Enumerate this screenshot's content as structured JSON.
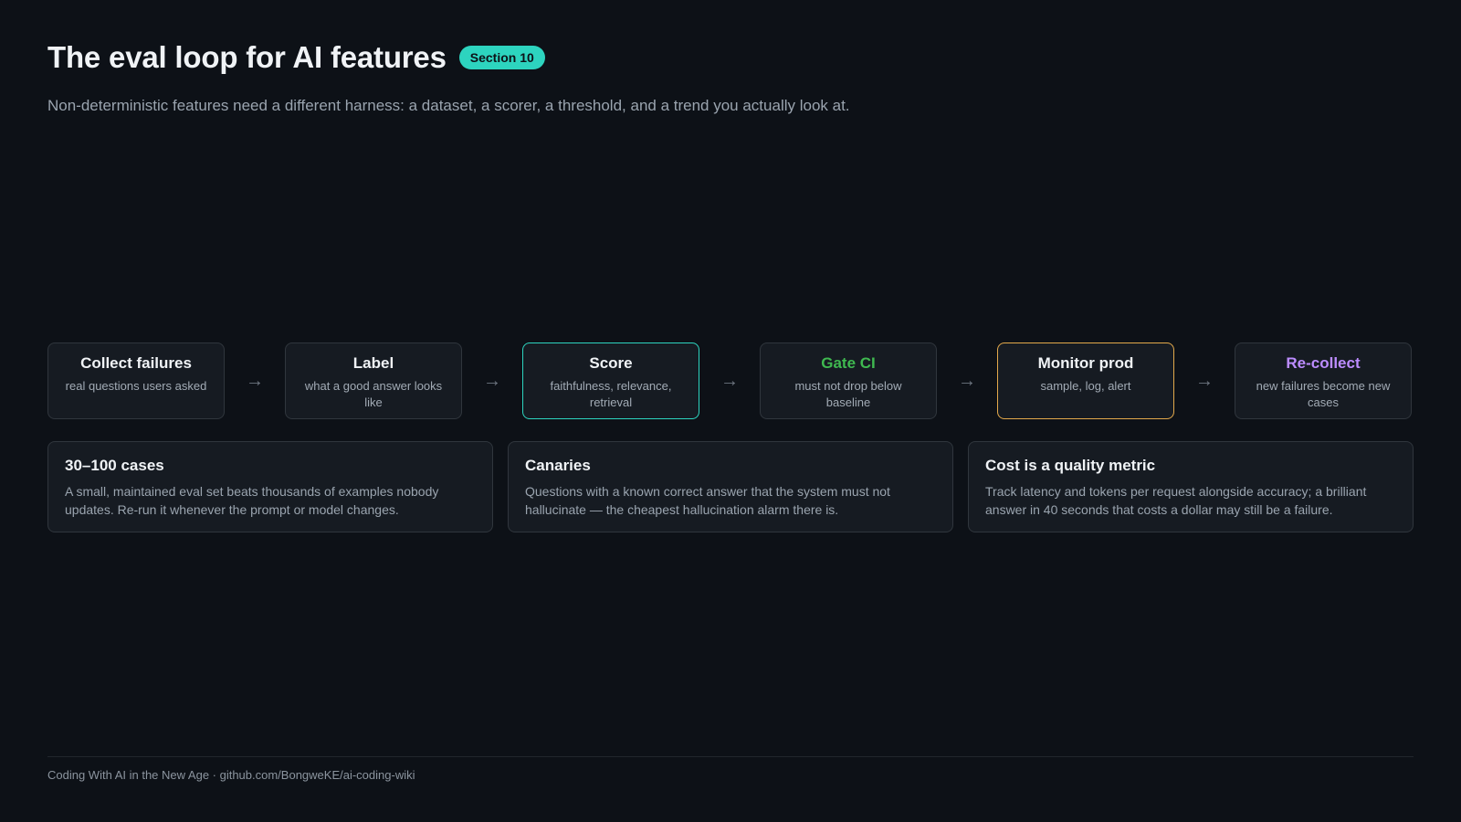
{
  "header": {
    "title": "The eval loop for AI features",
    "badge": "Section 10",
    "subtitle": "Non-deterministic features need a different harness: a dataset, a scorer, a threshold, and a trend you actually look at."
  },
  "colors": {
    "background": "#0d1117",
    "accent_teal": "#2dd4bf",
    "accent_amber": "#e3a94b",
    "accent_green": "#3fb950",
    "accent_purple": "#bc8cff"
  },
  "flow": {
    "arrow": "→",
    "steps": [
      {
        "title": "Collect failures",
        "desc": "real questions users asked"
      },
      {
        "title": "Label",
        "desc": "what a good answer looks like"
      },
      {
        "title": "Score",
        "desc": "faithfulness, relevance, retrieval"
      },
      {
        "title": "Gate CI",
        "desc": "must not drop below baseline"
      },
      {
        "title": "Monitor prod",
        "desc": "sample, log, alert"
      },
      {
        "title": "Re-collect",
        "desc": "new failures become new cases"
      }
    ]
  },
  "cards": [
    {
      "title": "30–100 cases",
      "text": "A small, maintained eval set beats thousands of examples nobody updates. Re-run it whenever the prompt or model changes."
    },
    {
      "title": "Canaries",
      "text": "Questions with a known correct answer that the system must not hallucinate — the cheapest hallucination alarm there is."
    },
    {
      "title": "Cost is a quality metric",
      "text": "Track latency and tokens per request alongside accuracy; a brilliant answer in 40 seconds that costs a dollar may still be a failure."
    }
  ],
  "footer": {
    "text": "Coding With AI in the New Age · github.com/BongweKE/ai-coding-wiki"
  }
}
